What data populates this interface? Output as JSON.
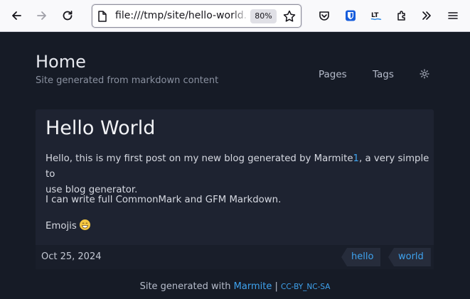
{
  "browser": {
    "url": "file:///tmp/site/hello-world.html",
    "zoom": "80%",
    "toolbar_icons": [
      "back-icon",
      "forward-icon",
      "reload-icon",
      "page-icon",
      "bookmark-star-icon",
      "pocket-icon",
      "bitwarden-icon",
      "languagetool-icon",
      "extensions-icon",
      "overflow-icon",
      "menu-icon"
    ]
  },
  "site": {
    "title": "Home",
    "subtitle": "Site generated from markdown content",
    "nav": [
      {
        "label": "Pages"
      },
      {
        "label": "Tags"
      }
    ],
    "theme_icon": "sun-icon"
  },
  "post": {
    "title": "Hello World",
    "para1_before": "Hello, this is my first post on my new blog generated by Marmite",
    "para1_footnote": "1",
    "para1_after": ", a very simple to",
    "para1_line2": "use blog generator.",
    "para2": "I can write full CommonMark and GFM Markdown.",
    "para3": "Emojis",
    "emoji": "grinning-face-with-smiling-eyes",
    "date": "Oct 25, 2024",
    "tags": [
      "hello",
      "world"
    ]
  },
  "footer": {
    "text": "Site generated with",
    "link": "Marmite",
    "separator": "|",
    "license": "CC-BY_NC-SA"
  },
  "colors": {
    "background": "#161b26",
    "card": "#1e2331",
    "link": "#3fa3ef"
  }
}
